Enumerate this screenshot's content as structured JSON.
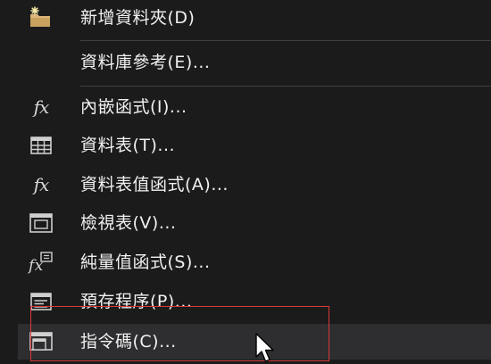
{
  "context_menu": {
    "items": [
      {
        "label": "新增資料夾(D)",
        "icon": "new-folder-icon"
      },
      {
        "label": "資料庫參考(E)...",
        "icon": ""
      },
      {
        "label": "內嵌函式(I)...",
        "icon": "fx-function-icon"
      },
      {
        "label": "資料表(T)...",
        "icon": "table-grid-icon"
      },
      {
        "label": "資料表值函式(A)...",
        "icon": "fx-function-icon"
      },
      {
        "label": "檢視表(V)...",
        "icon": "view-window-icon"
      },
      {
        "label": "純量值函式(S)...",
        "icon": "fx-scalar-function-icon"
      },
      {
        "label": "預存程序(P)...",
        "icon": "stored-procedure-icon"
      },
      {
        "label": "指令碼(C)...",
        "icon": "script-window-icon"
      }
    ],
    "highlighted_item": "指令碼(C)...",
    "colors": {
      "background": "#1b1b1c",
      "text": "#f1f1f1",
      "highlight": "#2e2e30",
      "separator": "#3f3f46",
      "focus_rectangle": "#d93a3a"
    }
  },
  "pointer": {
    "icon": "mouse-pointer-icon"
  }
}
